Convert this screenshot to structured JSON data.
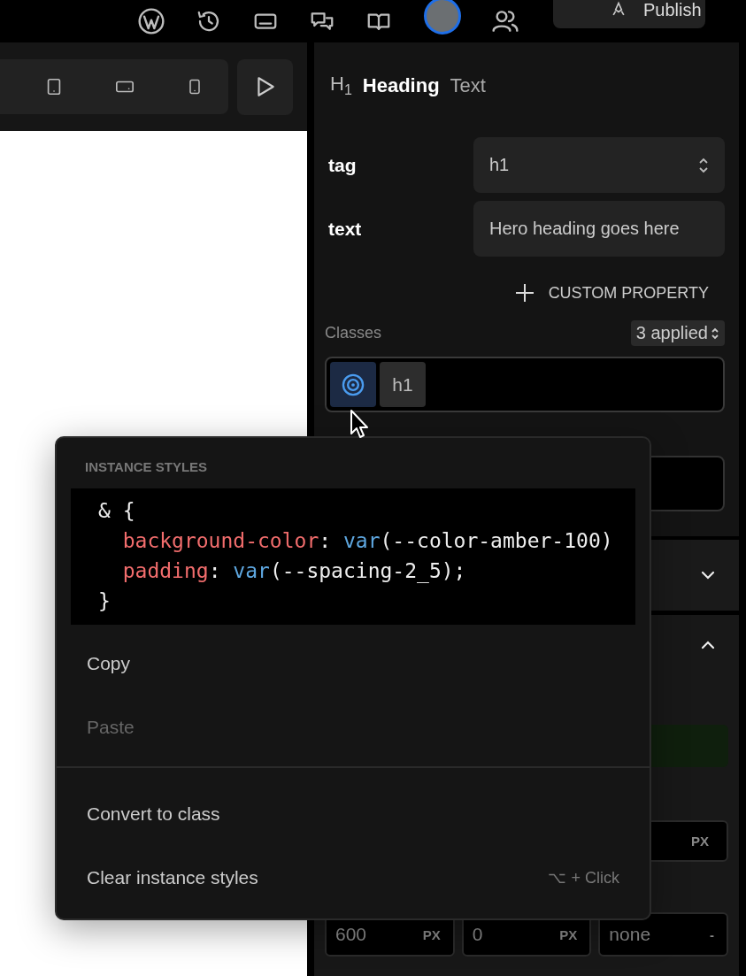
{
  "top_bar": {
    "publish_button": {
      "label": "Publish"
    }
  },
  "panel": {
    "element": {
      "badge": "H$_{1}$",
      "name": "Heading",
      "type": "Text"
    },
    "properties": [
      {
        "label": "tag",
        "value": "h1",
        "kind": "select"
      },
      {
        "label": "text",
        "value": "Hero heading goes here",
        "kind": "input"
      }
    ],
    "custom_property_button": {
      "label": "CUSTOM PROPERTY"
    },
    "classes": {
      "label": "Classes",
      "count": "3 applied",
      "tokens": [
        {
          "kind": "instance",
          "selected": true
        },
        {
          "kind": "class",
          "label": "h1",
          "selected": false
        }
      ]
    },
    "sections": [
      {
        "expanded": false
      },
      {
        "expanded": true
      }
    ],
    "unit_field": {
      "unit": "PX"
    },
    "size_fields": [
      {
        "placeholder": "600",
        "unit": "PX"
      },
      {
        "placeholder": "0",
        "unit": "PX"
      },
      {
        "placeholder": "none",
        "unit": "-"
      }
    ]
  },
  "context_menu": {
    "title": "INSTANCE STYLES",
    "code": [
      {
        "indented": false,
        "tokens": [
          {
            "kind": "plain",
            "text": "& {"
          }
        ]
      },
      {
        "indented": true,
        "tokens": [
          {
            "kind": "prop",
            "text": "background-color"
          },
          {
            "kind": "plain",
            "text": ": "
          },
          {
            "kind": "func",
            "text": "var"
          },
          {
            "kind": "plain",
            "text": "(--color-amber-100)"
          }
        ]
      },
      {
        "indented": true,
        "tokens": [
          {
            "kind": "prop",
            "text": "padding"
          },
          {
            "kind": "plain",
            "text": ": "
          },
          {
            "kind": "func",
            "text": "var"
          },
          {
            "kind": "plain",
            "text": "(--spacing-2_5);"
          }
        ]
      },
      {
        "indented": false,
        "tokens": [
          {
            "kind": "plain",
            "text": "}"
          }
        ]
      }
    ],
    "groups": [
      [
        {
          "label": "Copy",
          "disabled": false
        },
        {
          "label": "Paste",
          "disabled": true
        }
      ],
      [
        {
          "label": "Convert to class",
          "disabled": false
        },
        {
          "label": "Clear instance styles",
          "disabled": false,
          "shortcut": "⌥ + Click"
        }
      ]
    ]
  }
}
